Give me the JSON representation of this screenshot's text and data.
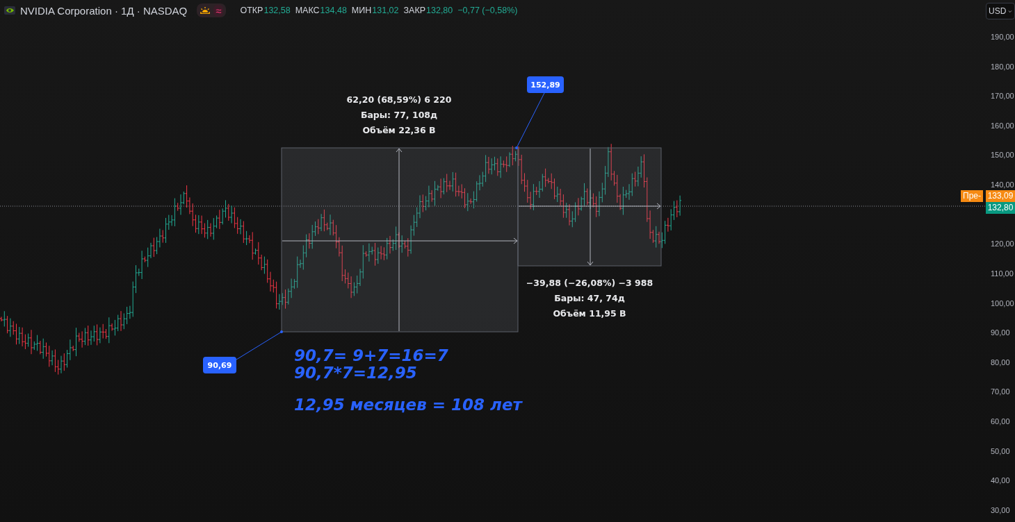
{
  "header": {
    "symbol": "NVIDIA Corporation · 1Д · NASDAQ",
    "session_sign": "≈",
    "ohlc": [
      {
        "label": "ОТКР",
        "value": "132,58"
      },
      {
        "label": "МАКС",
        "value": "134,48"
      },
      {
        "label": "МИН",
        "value": "131,02"
      },
      {
        "label": "ЗАКР",
        "value": "132,80"
      }
    ],
    "change": "−0,77 (−0,58%)"
  },
  "currency_button": "USD",
  "price_axis": {
    "labels": [
      "190,00",
      "180,00",
      "170,00",
      "160,00",
      "150,00",
      "140,00",
      "120,00",
      "110,00",
      "100,00",
      "90,00",
      "80,00",
      "70,00",
      "60,00",
      "50,00",
      "40,00",
      "30,00"
    ]
  },
  "price_tags": [
    {
      "kind": "premarket-name",
      "text": "Пре-"
    },
    {
      "kind": "premarket",
      "text": "133,09"
    },
    {
      "kind": "last",
      "text": "132,80"
    }
  ],
  "measurements": [
    {
      "kind": "up",
      "lines": [
        "62,20 (68,59%) 6 220",
        "Бары: 77, 108д",
        "Объём 22,36 B"
      ]
    },
    {
      "kind": "down",
      "lines": [
        "−39,88 (−26,08%) −3 988",
        "Бары: 47, 74д",
        "Объём 11,95 B"
      ]
    }
  ],
  "price_callouts": [
    "152,89",
    "90,69"
  ],
  "note": {
    "paragraphs": [
      [
        "90,7= 9+7=16=7",
        "90,7*7=12,95"
      ],
      [
        "12,95 месяцев = 108 лет"
      ]
    ]
  }
}
